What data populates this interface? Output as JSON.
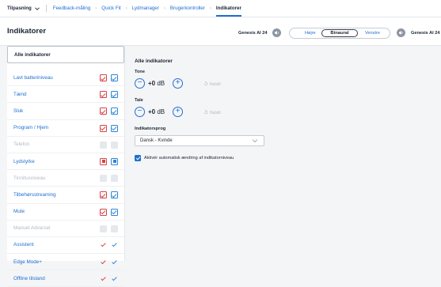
{
  "topnav": {
    "first": "Tilpasning",
    "crumbs": [
      "Feedback-måling",
      "Quick Fit",
      "Lydmanager",
      "Brugerkontroller",
      "Indikatorer"
    ]
  },
  "header": {
    "title": "Indikatorer",
    "device_left": "Genesis AI 24",
    "device_right": "Genesis AI 24",
    "side_options": [
      "Højre",
      "Binaural",
      "Venstre"
    ],
    "selected_side": "Binaural"
  },
  "sidebar": {
    "all_label": "Alle indikatorer",
    "items": [
      {
        "label": "Lavt batteriniveau",
        "enabled": true,
        "marks": [
          "box-red",
          "box-blue"
        ]
      },
      {
        "label": "Tænd",
        "enabled": true,
        "marks": [
          "box-red",
          "box-blue"
        ]
      },
      {
        "label": "Sluk",
        "enabled": true,
        "marks": [
          "box-red",
          "box-blue"
        ]
      },
      {
        "label": "Program / Hjem",
        "enabled": true,
        "marks": [
          "box-red",
          "box-blue"
        ]
      },
      {
        "label": "Telefon",
        "enabled": false,
        "marks": [
          "grey",
          "grey"
        ]
      },
      {
        "label": "Lydstyrke",
        "enabled": true,
        "marks": [
          "partial-red",
          "partial-blue"
        ]
      },
      {
        "label": "Tinnitusniveau",
        "enabled": false,
        "marks": [
          "grey",
          "grey"
        ]
      },
      {
        "label": "Tilbehørsstreaming",
        "enabled": true,
        "marks": [
          "box-red",
          "box-blue"
        ]
      },
      {
        "label": "Mute",
        "enabled": true,
        "marks": [
          "box-red",
          "box-blue"
        ]
      },
      {
        "label": "Manuel Advarsel",
        "enabled": false,
        "marks": [
          "grey",
          "grey"
        ]
      },
      {
        "label": "Assistent",
        "enabled": true,
        "marks": [
          "tick-red",
          "tick-blue"
        ]
      },
      {
        "label": "Edge Mode+",
        "enabled": true,
        "marks": [
          "tick-red",
          "tick-blue"
        ]
      },
      {
        "label": "Offline tilstand",
        "enabled": true,
        "marks": [
          "tick-red",
          "tick-blue"
        ]
      }
    ]
  },
  "main": {
    "heading": "Alle indikatorer",
    "tone": {
      "label": "Tone",
      "value": "+0",
      "unit": "dB",
      "reset_label": "Nulstil"
    },
    "tale": {
      "label": "Tale",
      "value": "+0",
      "unit": "dB",
      "reset_label": "Nulstil"
    },
    "language": {
      "label": "Indikatorsprog",
      "value": "Dansk - Kvinde"
    },
    "auto_change": {
      "label": "Aktivér automatisk ændring af indikatorniveau",
      "checked": true
    }
  },
  "colors": {
    "accent": "#1f6fd1",
    "left_ear": "#d64245",
    "right_ear": "#2d86d9"
  }
}
